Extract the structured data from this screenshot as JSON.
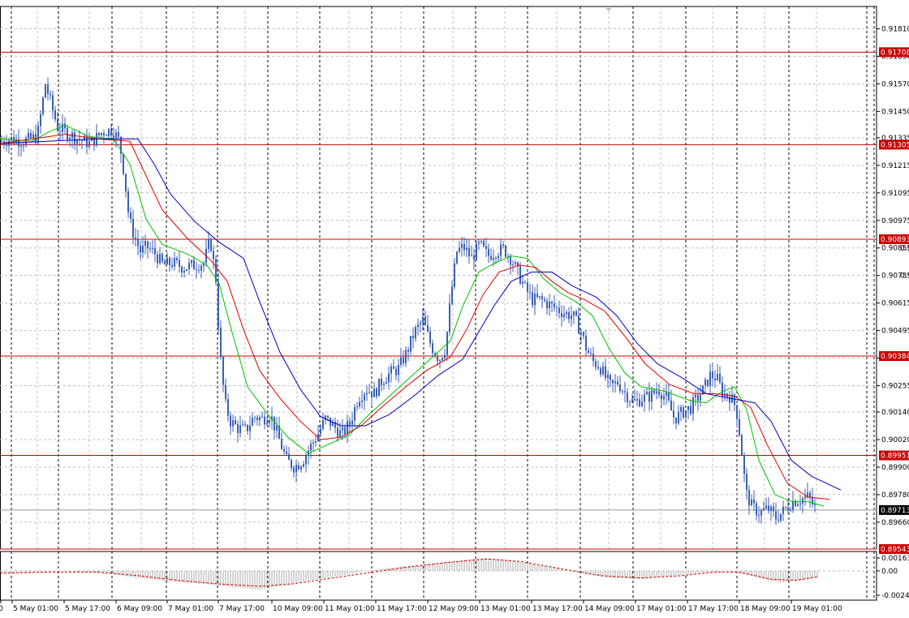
{
  "chart_data": {
    "type": "candlestick",
    "main_panel": {
      "ylim": [
        0.89543,
        0.919
      ],
      "price_scale_labels": [
        "0.91810",
        "0.91690",
        "0.91570",
        "0.91450",
        "0.91335",
        "0.91215",
        "0.91095",
        "0.90975",
        "0.90855",
        "0.90735",
        "0.90615",
        "0.90495",
        "0.90375",
        "0.90255",
        "0.90140",
        "0.90020",
        "0.89900",
        "0.89780",
        "0.89660"
      ],
      "horizontal_levels": [
        {
          "label": "0.91708",
          "value": 0.91708,
          "color": "#cc0000"
        },
        {
          "label": "0.91305",
          "value": 0.91305,
          "color": "#cc0000"
        },
        {
          "label": "0.90893",
          "value": 0.90893,
          "color": "#cc0000"
        },
        {
          "label": "0.90384",
          "value": 0.90384,
          "color": "#cc0000"
        },
        {
          "label": "0.89951",
          "value": 0.89951,
          "color": "#cc0000"
        },
        {
          "label": "0.89543",
          "value": 0.89543,
          "color": "#cc0000"
        }
      ],
      "current_price": {
        "label": "0.89713",
        "value": 0.89713,
        "color": "#000000"
      },
      "right_edge_labels": [
        "0.90855",
        "0.90735"
      ],
      "close_path": [
        [
          0,
          0.9132
        ],
        [
          12,
          0.9133
        ],
        [
          28,
          0.9132
        ],
        [
          45,
          0.9134
        ],
        [
          55,
          0.9157
        ],
        [
          62,
          0.9148
        ],
        [
          70,
          0.9138
        ],
        [
          80,
          0.9136
        ],
        [
          95,
          0.9133
        ],
        [
          110,
          0.9131
        ],
        [
          125,
          0.9136
        ],
        [
          138,
          0.9137
        ],
        [
          146,
          0.9132
        ],
        [
          152,
          0.9118
        ],
        [
          158,
          0.9098
        ],
        [
          165,
          0.909
        ],
        [
          172,
          0.9084
        ],
        [
          180,
          0.9086
        ],
        [
          190,
          0.9083
        ],
        [
          200,
          0.9078
        ],
        [
          212,
          0.9079
        ],
        [
          225,
          0.9077
        ],
        [
          240,
          0.9078
        ],
        [
          250,
          0.9079
        ],
        [
          258,
          0.9089
        ],
        [
          265,
          0.9072
        ],
        [
          270,
          0.904
        ],
        [
          276,
          0.9018
        ],
        [
          283,
          0.901
        ],
        [
          292,
          0.9007
        ],
        [
          302,
          0.9006
        ],
        [
          312,
          0.9012
        ],
        [
          322,
          0.9011
        ],
        [
          332,
          0.9013
        ],
        [
          342,
          0.9003
        ],
        [
          352,
          0.8993
        ],
        [
          362,
          0.899
        ],
        [
          372,
          0.8993
        ],
        [
          380,
          0.8998
        ],
        [
          390,
          0.9004
        ],
        [
          400,
          0.9011
        ],
        [
          410,
          0.9008
        ],
        [
          420,
          0.9004
        ],
        [
          430,
          0.9009
        ],
        [
          440,
          0.902
        ],
        [
          450,
          0.9024
        ],
        [
          460,
          0.9022
        ],
        [
          470,
          0.9028
        ],
        [
          480,
          0.9031
        ],
        [
          490,
          0.9033
        ],
        [
          500,
          0.904
        ],
        [
          510,
          0.9049
        ],
        [
          520,
          0.9054
        ],
        [
          530,
          0.9043
        ],
        [
          540,
          0.9037
        ],
        [
          548,
          0.9042
        ],
        [
          555,
          0.9066
        ],
        [
          562,
          0.9084
        ],
        [
          570,
          0.9086
        ],
        [
          580,
          0.9081
        ],
        [
          590,
          0.9087
        ],
        [
          600,
          0.9082
        ],
        [
          610,
          0.9084
        ],
        [
          620,
          0.9085
        ],
        [
          630,
          0.908
        ],
        [
          638,
          0.9074
        ],
        [
          646,
          0.9068
        ],
        [
          655,
          0.9063
        ],
        [
          665,
          0.9063
        ],
        [
          675,
          0.9061
        ],
        [
          685,
          0.9059
        ],
        [
          695,
          0.9057
        ],
        [
          705,
          0.9056
        ],
        [
          715,
          0.9049
        ],
        [
          722,
          0.9041
        ],
        [
          730,
          0.9036
        ],
        [
          738,
          0.9034
        ],
        [
          745,
          0.9029
        ],
        [
          752,
          0.9025
        ],
        [
          760,
          0.9027
        ],
        [
          770,
          0.9022
        ],
        [
          780,
          0.9018
        ],
        [
          790,
          0.902
        ],
        [
          800,
          0.9021
        ],
        [
          810,
          0.9024
        ],
        [
          820,
          0.902
        ],
        [
          830,
          0.9011
        ],
        [
          840,
          0.9014
        ],
        [
          850,
          0.9016
        ],
        [
          858,
          0.902
        ],
        [
          866,
          0.9024
        ],
        [
          874,
          0.903
        ],
        [
          882,
          0.9029
        ],
        [
          890,
          0.9022
        ],
        [
          898,
          0.9021
        ],
        [
          906,
          0.9016
        ],
        [
          912,
          0.9
        ],
        [
          918,
          0.8979
        ],
        [
          925,
          0.8973
        ],
        [
          935,
          0.897
        ],
        [
          945,
          0.8972
        ],
        [
          955,
          0.8968
        ],
        [
          965,
          0.8971
        ],
        [
          975,
          0.8975
        ],
        [
          985,
          0.8976
        ],
        [
          995,
          0.8977
        ],
        [
          1005,
          0.8971
        ]
      ],
      "moving_averages": [
        {
          "color": "#00c000",
          "points": [
            [
              0,
              0.9133
            ],
            [
              40,
              0.9132
            ],
            [
              60,
              0.9136
            ],
            [
              80,
              0.9139
            ],
            [
              110,
              0.9134
            ],
            [
              140,
              0.9133
            ],
            [
              160,
              0.9122
            ],
            [
              180,
              0.9098
            ],
            [
              200,
              0.9087
            ],
            [
              230,
              0.9083
            ],
            [
              255,
              0.9078
            ],
            [
              270,
              0.907
            ],
            [
              285,
              0.905
            ],
            [
              305,
              0.9025
            ],
            [
              330,
              0.9013
            ],
            [
              355,
              0.9003
            ],
            [
              380,
              0.8996
            ],
            [
              405,
              0.9
            ],
            [
              430,
              0.9004
            ],
            [
              455,
              0.9013
            ],
            [
              480,
              0.9021
            ],
            [
              505,
              0.9029
            ],
            [
              530,
              0.9037
            ],
            [
              555,
              0.9045
            ],
            [
              570,
              0.906
            ],
            [
              590,
              0.9075
            ],
            [
              610,
              0.9079
            ],
            [
              630,
              0.9082
            ],
            [
              650,
              0.9081
            ],
            [
              670,
              0.9072
            ],
            [
              690,
              0.9066
            ],
            [
              710,
              0.9062
            ],
            [
              730,
              0.9056
            ],
            [
              750,
              0.9042
            ],
            [
              770,
              0.9031
            ],
            [
              790,
              0.9025
            ],
            [
              820,
              0.9023
            ],
            [
              850,
              0.9019
            ],
            [
              870,
              0.9018
            ],
            [
              890,
              0.9023
            ],
            [
              905,
              0.9025
            ],
            [
              920,
              0.9015
            ],
            [
              935,
              0.8993
            ],
            [
              955,
              0.8978
            ],
            [
              975,
              0.8975
            ],
            [
              995,
              0.8975
            ],
            [
              1015,
              0.8973
            ]
          ]
        },
        {
          "color": "#e00000",
          "points": [
            [
              0,
              0.9131
            ],
            [
              40,
              0.9133
            ],
            [
              80,
              0.9135
            ],
            [
              120,
              0.9133
            ],
            [
              160,
              0.9132
            ],
            [
              180,
              0.9117
            ],
            [
              200,
              0.9102
            ],
            [
              230,
              0.909
            ],
            [
              260,
              0.908
            ],
            [
              280,
              0.9071
            ],
            [
              300,
              0.905
            ],
            [
              320,
              0.9032
            ],
            [
              345,
              0.902
            ],
            [
              370,
              0.901
            ],
            [
              395,
              0.9002
            ],
            [
              420,
              0.9003
            ],
            [
              445,
              0.9008
            ],
            [
              470,
              0.9016
            ],
            [
              500,
              0.9025
            ],
            [
              525,
              0.9032
            ],
            [
              555,
              0.9038
            ],
            [
              575,
              0.905
            ],
            [
              595,
              0.9065
            ],
            [
              615,
              0.9075
            ],
            [
              640,
              0.9078
            ],
            [
              660,
              0.9077
            ],
            [
              680,
              0.9071
            ],
            [
              700,
              0.9066
            ],
            [
              720,
              0.9063
            ],
            [
              745,
              0.9058
            ],
            [
              770,
              0.9047
            ],
            [
              795,
              0.9035
            ],
            [
              825,
              0.9026
            ],
            [
              855,
              0.9022
            ],
            [
              880,
              0.9022
            ],
            [
              905,
              0.9021
            ],
            [
              925,
              0.9016
            ],
            [
              945,
              0.9
            ],
            [
              970,
              0.8983
            ],
            [
              995,
              0.8977
            ],
            [
              1022,
              0.8976
            ]
          ]
        },
        {
          "color": "#0000c0",
          "points": [
            [
              0,
              0.9131
            ],
            [
              60,
              0.9132
            ],
            [
              120,
              0.9133
            ],
            [
              170,
              0.9133
            ],
            [
              190,
              0.9122
            ],
            [
              210,
              0.9109
            ],
            [
              240,
              0.9097
            ],
            [
              270,
              0.9088
            ],
            [
              300,
              0.9081
            ],
            [
              320,
              0.9062
            ],
            [
              345,
              0.904
            ],
            [
              370,
              0.9024
            ],
            [
              395,
              0.9012
            ],
            [
              420,
              0.9008
            ],
            [
              450,
              0.9008
            ],
            [
              480,
              0.9013
            ],
            [
              510,
              0.9021
            ],
            [
              540,
              0.903
            ],
            [
              570,
              0.9037
            ],
            [
              590,
              0.9049
            ],
            [
              610,
              0.9061
            ],
            [
              630,
              0.9071
            ],
            [
              655,
              0.9075
            ],
            [
              680,
              0.9075
            ],
            [
              705,
              0.9069
            ],
            [
              735,
              0.9064
            ],
            [
              760,
              0.9056
            ],
            [
              785,
              0.9044
            ],
            [
              810,
              0.9035
            ],
            [
              840,
              0.9029
            ],
            [
              870,
              0.9022
            ],
            [
              900,
              0.902
            ],
            [
              930,
              0.9018
            ],
            [
              950,
              0.901
            ],
            [
              975,
              0.8993
            ],
            [
              1000,
              0.8986
            ],
            [
              1036,
              0.898
            ]
          ]
        }
      ]
    },
    "oscillator_panel": {
      "scale_labels": [
        "0.001636",
        "0.00",
        "-0.00247"
      ],
      "ylim": [
        -0.00247,
        0.001636
      ],
      "zero_line": 0.0,
      "histogram": [
        [
          0,
          -0.0002
        ],
        [
          40,
          -0.0001
        ],
        [
          80,
          0.0
        ],
        [
          130,
          -0.0002
        ],
        [
          170,
          -0.0006
        ],
        [
          210,
          -0.0009
        ],
        [
          250,
          -0.0011
        ],
        [
          290,
          -0.0014
        ],
        [
          320,
          -0.0016
        ],
        [
          350,
          -0.0012
        ],
        [
          380,
          -0.0008
        ],
        [
          420,
          -0.0004
        ],
        [
          460,
          0.0001
        ],
        [
          500,
          0.0004
        ],
        [
          540,
          0.0007
        ],
        [
          580,
          0.001
        ],
        [
          600,
          0.0011
        ],
        [
          630,
          0.0009
        ],
        [
          670,
          0.0004
        ],
        [
          710,
          -0.0001
        ],
        [
          750,
          -0.0006
        ],
        [
          790,
          -0.0007
        ],
        [
          830,
          -0.0004
        ],
        [
          870,
          -0.0001
        ],
        [
          900,
          0.0
        ],
        [
          930,
          -0.0005
        ],
        [
          960,
          -0.001
        ],
        [
          990,
          -0.0008
        ],
        [
          1008,
          -0.0005
        ]
      ],
      "signal": [
        [
          0,
          -0.0002
        ],
        [
          60,
          -0.0001
        ],
        [
          120,
          -0.0001
        ],
        [
          170,
          -0.0004
        ],
        [
          220,
          -0.0008
        ],
        [
          270,
          -0.0011
        ],
        [
          320,
          -0.0013
        ],
        [
          360,
          -0.0011
        ],
        [
          400,
          -0.0007
        ],
        [
          450,
          -0.0002
        ],
        [
          500,
          0.0003
        ],
        [
          550,
          0.0007
        ],
        [
          600,
          0.001
        ],
        [
          640,
          0.0008
        ],
        [
          690,
          0.0002
        ],
        [
          740,
          -0.0004
        ],
        [
          790,
          -0.0006
        ],
        [
          840,
          -0.0004
        ],
        [
          880,
          -0.0001
        ],
        [
          910,
          -0.0001
        ],
        [
          950,
          -0.0007
        ],
        [
          980,
          -0.0008
        ],
        [
          1008,
          -0.0005
        ]
      ]
    },
    "x_tick_labels": [
      "0",
      "5 May 01:00",
      "5 May 17:00",
      "6 May 09:00",
      "7 May 01:00",
      "7 May 17:00",
      "10 May 09:00",
      "11 May 01:00",
      "11 May 17:00",
      "12 May 09:00",
      "13 May 01:00",
      "13 May 17:00",
      "14 May 09:00",
      "17 May 01:00",
      "17 May 17:00",
      "18 May 09:00",
      "19 May 01:00"
    ],
    "grid": true
  }
}
